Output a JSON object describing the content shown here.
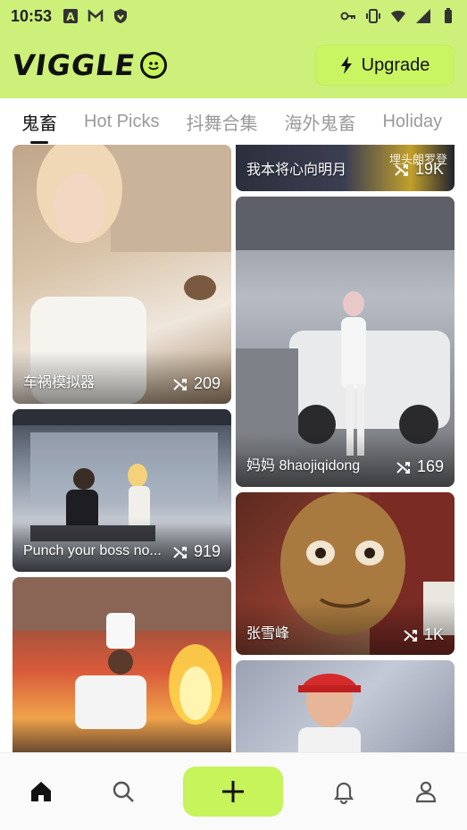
{
  "status": {
    "time": "10:53",
    "icons": [
      "a-badge-icon",
      "m-mail-icon",
      "shield-icon",
      "key-icon",
      "vibrate-icon",
      "wifi-icon",
      "signal-icon",
      "battery-icon"
    ]
  },
  "header": {
    "logo_text": "VIGGLE",
    "upgrade_label": "Upgrade",
    "accent_color": "#ccf07a",
    "button_color": "#c9f562"
  },
  "tabs": [
    {
      "label": "鬼畜",
      "active": true
    },
    {
      "label": "Hot Picks",
      "active": false
    },
    {
      "label": "抖舞合集",
      "active": false
    },
    {
      "label": "海外鬼畜",
      "active": false
    },
    {
      "label": "Holiday",
      "active": false
    }
  ],
  "cards": [
    {
      "title": "车祸模拟器",
      "count": "209"
    },
    {
      "title": "我本将心向明月",
      "count": "19K",
      "overlay_text": "埋头朗罗登"
    },
    {
      "title": "妈妈 8haojiqidong",
      "count": "169"
    },
    {
      "title": "Punch your boss no...",
      "count": "919"
    },
    {
      "title": "张雪峰",
      "count": "1K"
    },
    {
      "title": "",
      "count": ""
    },
    {
      "title": "",
      "count": ""
    }
  ],
  "nav": {
    "items": [
      "home-icon",
      "search-icon",
      "plus-icon",
      "bell-icon",
      "user-icon"
    ]
  }
}
